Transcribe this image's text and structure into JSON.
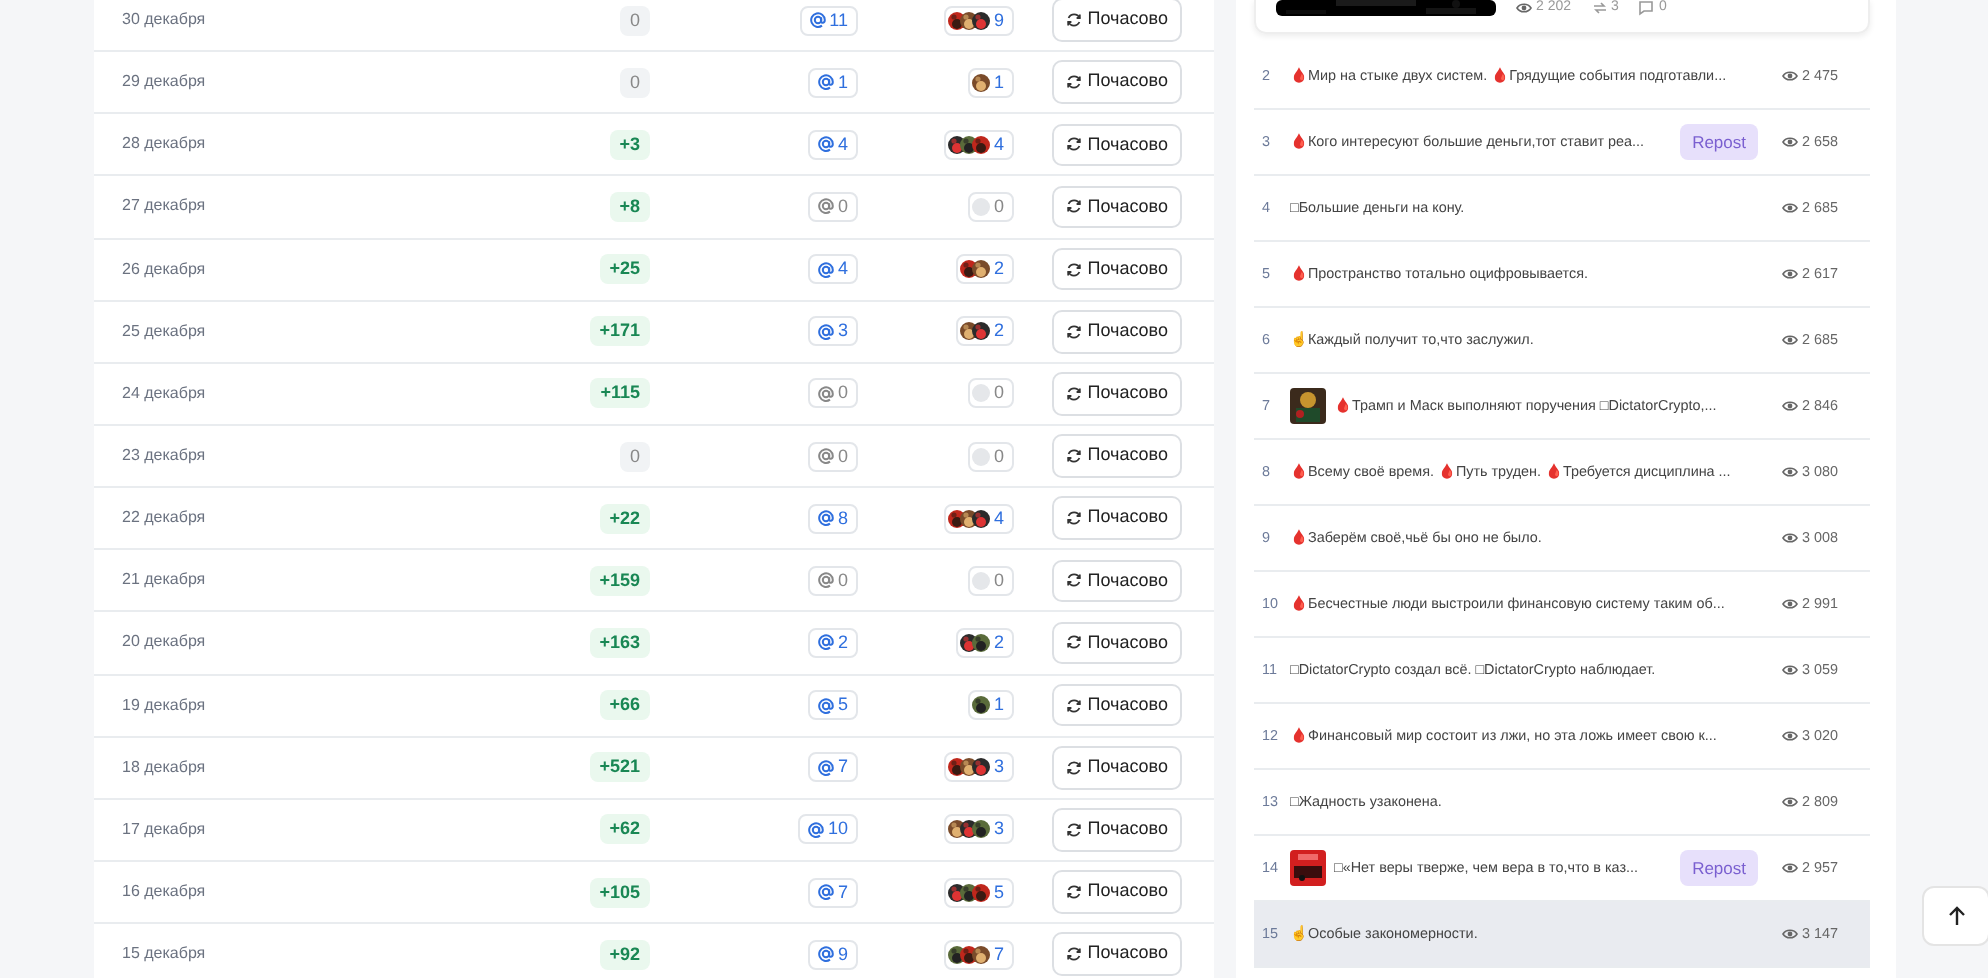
{
  "days": [
    {
      "date": "30 декабря",
      "delta": "0",
      "delta_positive": false,
      "mentions": "11",
      "mentions_active": true,
      "reactions": "9",
      "button": "Почасово"
    },
    {
      "date": "29 декабря",
      "delta": "0",
      "delta_positive": false,
      "mentions": "1",
      "mentions_active": true,
      "reactions": "1",
      "button": "Почасово"
    },
    {
      "date": "28 декабря",
      "delta": "+3",
      "delta_positive": true,
      "mentions": "4",
      "mentions_active": true,
      "reactions": "4",
      "button": "Почасово"
    },
    {
      "date": "27 декабря",
      "delta": "+8",
      "delta_positive": true,
      "mentions": "0",
      "mentions_active": false,
      "reactions": "0",
      "button": "Почасово"
    },
    {
      "date": "26 декабря",
      "delta": "+25",
      "delta_positive": true,
      "mentions": "4",
      "mentions_active": true,
      "reactions": "2",
      "button": "Почасово"
    },
    {
      "date": "25 декабря",
      "delta": "+171",
      "delta_positive": true,
      "mentions": "3",
      "mentions_active": true,
      "reactions": "2",
      "button": "Почасово"
    },
    {
      "date": "24 декабря",
      "delta": "+115",
      "delta_positive": true,
      "mentions": "0",
      "mentions_active": false,
      "reactions": "0",
      "button": "Почасово"
    },
    {
      "date": "23 декабря",
      "delta": "0",
      "delta_positive": false,
      "mentions": "0",
      "mentions_active": false,
      "reactions": "0",
      "button": "Почасово"
    },
    {
      "date": "22 декабря",
      "delta": "+22",
      "delta_positive": true,
      "mentions": "8",
      "mentions_active": true,
      "reactions": "4",
      "button": "Почасово"
    },
    {
      "date": "21 декабря",
      "delta": "+159",
      "delta_positive": true,
      "mentions": "0",
      "mentions_active": false,
      "reactions": "0",
      "button": "Почасово"
    },
    {
      "date": "20 декабря",
      "delta": "+163",
      "delta_positive": true,
      "mentions": "2",
      "mentions_active": true,
      "reactions": "2",
      "button": "Почасово"
    },
    {
      "date": "19 декабря",
      "delta": "+66",
      "delta_positive": true,
      "mentions": "5",
      "mentions_active": true,
      "reactions": "1",
      "button": "Почасово"
    },
    {
      "date": "18 декабря",
      "delta": "+521",
      "delta_positive": true,
      "mentions": "7",
      "mentions_active": true,
      "reactions": "3",
      "button": "Почасово"
    },
    {
      "date": "17 декабря",
      "delta": "+62",
      "delta_positive": true,
      "mentions": "10",
      "mentions_active": true,
      "reactions": "3",
      "button": "Почасово"
    },
    {
      "date": "16 декабря",
      "delta": "+105",
      "delta_positive": true,
      "mentions": "7",
      "mentions_active": true,
      "reactions": "5",
      "button": "Почасово"
    },
    {
      "date": "15 декабря",
      "delta": "+92",
      "delta_positive": true,
      "mentions": "9",
      "mentions_active": true,
      "reactions": "7",
      "button": "Почасово"
    }
  ],
  "top_post": {
    "kind": "picture",
    "views": "2 202",
    "reposts": "3",
    "comments": "0"
  },
  "posts": [
    {
      "number": "2",
      "text": "🩸Мир на стыке двух систем. 🩸Грядущие события подготавли...",
      "views": "2 475",
      "selected": false
    },
    {
      "number": "3",
      "text": "🩸Кого интересуют большие деньги,тот ставит реа...",
      "badge": "Repost",
      "views": "2 658",
      "selected": false
    },
    {
      "number": "4",
      "text": "□Большие деньги на кону.",
      "views": "2 685",
      "selected": false
    },
    {
      "number": "5",
      "text": "🩸Пространство тотально оцифровывается.",
      "views": "2 617",
      "selected": false
    },
    {
      "number": "6",
      "text": "☝Каждый получит то,что заслужил.",
      "views": "2 685",
      "selected": false
    },
    {
      "number": "7",
      "text": "🩸Трамп и Маск выполняют поручения □DictatorCrypto,...",
      "views": "2 846",
      "selected": false
    },
    {
      "number": "8",
      "text": "🩸Всему своё время. 🩸Путь труден. 🩸Требуется дисциплина ...",
      "views": "3 080",
      "selected": false
    },
    {
      "number": "9",
      "text": "🩸Заберём своё,чьё бы оно не было.",
      "views": "3 008",
      "selected": false
    },
    {
      "number": "10",
      "text": "🩸Бесчестные люди выстроили финансовую систему таким об...",
      "views": "2 991",
      "selected": false
    },
    {
      "number": "11",
      "text": "□DictatorCrypto создал всё. □DictatorCrypto наблюдает.",
      "views": "3 059",
      "selected": false
    },
    {
      "number": "12",
      "text": "🩸Финансовый мир состоит из лжи, но эта ложь имеет свою к...",
      "views": "3 020",
      "selected": false
    },
    {
      "number": "13",
      "text": "□Жадность узаконена.",
      "views": "2 809",
      "selected": false
    },
    {
      "number": "14",
      "text": "□«Нет веры тверже, чем вера в то,что в каз...",
      "badge": "Repost",
      "views": "2 957",
      "selected": false
    },
    {
      "number": "15",
      "text": "☝Особые закономерности.",
      "views": "3 147",
      "selected": true
    }
  ]
}
